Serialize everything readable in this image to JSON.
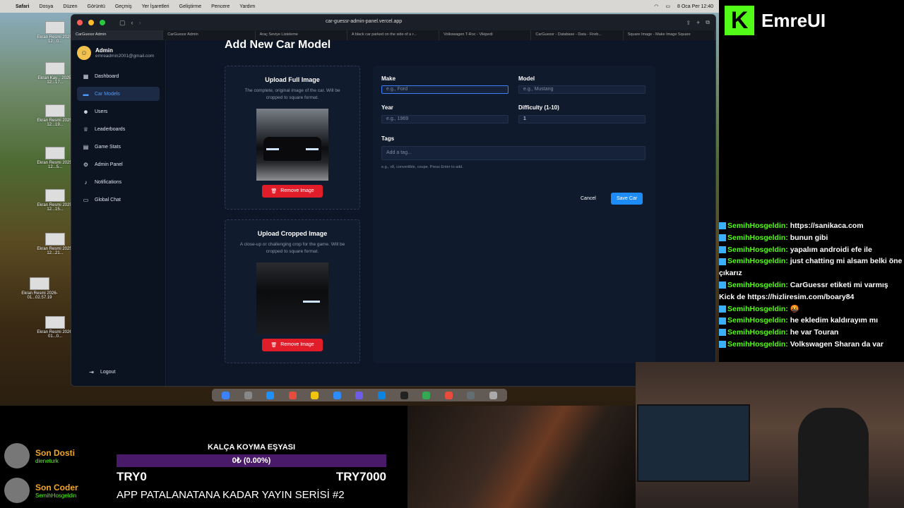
{
  "menubar": {
    "apple": "",
    "app": "Safari",
    "items": [
      "Dosya",
      "Düzen",
      "Görüntü",
      "Geçmiş",
      "Yer İşaretleri",
      "Geliştirme",
      "Pencere",
      "Yardım"
    ],
    "datetime": "8 Oca Per 12:40"
  },
  "desktop_icons": [
    {
      "label": "Ekran Resmi 2025-12...0..."
    },
    {
      "label": "Ekran Kay... 2025-12...17..."
    },
    {
      "label": "Ekran Resmi 2025-12...19..."
    },
    {
      "label": "Ekran Resmi 2025-12...5..."
    },
    {
      "label": "Ekran Resmi 2025-12...15..."
    },
    {
      "label": "Ekran Resmi 2025-12...21..."
    },
    {
      "label": "Ekran Resmi 2026-01...02.57.19"
    },
    {
      "label": "Ekran Resmi 2026-01...0..."
    }
  ],
  "browser": {
    "url": "car-guessr-admin-panel.vercel.app",
    "tabs": [
      "CarGuessr Admin",
      "CarGuessr Admin",
      "Araç Seviye Listeleme",
      "A black car parked on the side of a r...",
      "Volkswagen T-Roc - Vikipedi",
      "CarGuessr - Database - Data - Fireb...",
      "Square Image - Make Image Square"
    ]
  },
  "sidebar": {
    "user_name": "Admin",
    "user_email": "emreadmin2001@gmail.com",
    "items": [
      "Dashboard",
      "Car Models",
      "Users",
      "Leaderboards",
      "Game Stats",
      "Admin Panel",
      "Notifications",
      "Global Chat"
    ],
    "logout": "Logout"
  },
  "page": {
    "title": "Add New Car Model",
    "full_image": {
      "title": "Upload Full Image",
      "desc": "The complete, original image of the car. Will be cropped to square format.",
      "remove": "Remove Image"
    },
    "cropped_image": {
      "title": "Upload Cropped Image",
      "desc": "A close-up or challenging crop for the game. Will be cropped to square format.",
      "remove": "Remove Image"
    },
    "form": {
      "make_label": "Make",
      "make_placeholder": "e.g., Ford",
      "model_label": "Model",
      "model_placeholder": "e.g., Mustang",
      "year_label": "Year",
      "year_placeholder": "e.g., 1969",
      "difficulty_label": "Difficulty (1-10)",
      "difficulty_value": "1",
      "tags_label": "Tags",
      "tags_placeholder": "Add a tag...",
      "tags_hint": "e.g., v8, convertible, coupe. Press Enter to add.",
      "cancel": "Cancel",
      "save": "Save Car"
    }
  },
  "stream": {
    "brand": "EmreUI",
    "chat": [
      {
        "user": "SemihHosgeldin:",
        "msg": "https://sanikaca.com"
      },
      {
        "user": "SemihHosgeldin:",
        "msg": "bunun gibi"
      },
      {
        "user": "SemihHosgeldin:",
        "msg": "yapalım androidi efe ile"
      },
      {
        "user": "SemihHosgeldin:",
        "msg": "just chatting mi alsam belki öne çıkarız"
      },
      {
        "user": "SemihHosgeldin:",
        "msg": "CarGuessr etiketi mi varmış Kick de https://hizliresim.com/boary84"
      },
      {
        "user": "SemihHosgeldin:",
        "msg": "🤬"
      },
      {
        "user": "SemihHosgeldin:",
        "msg": "he ekledim kaldırayım mı"
      },
      {
        "user": "SemihHosgeldin:",
        "msg": "he var Touran"
      },
      {
        "user": "SemihHosgeldin:",
        "msg": "Volkswagen Sharan da var"
      }
    ],
    "last_follower": {
      "title": "Son Dosti",
      "name": "dieneturk"
    },
    "last_coder": {
      "title": "Son Coder",
      "name": "SemihHosgeldin"
    },
    "goal": {
      "title": "KALÇA KOYMA EŞYASI",
      "progress_text": "0₺ (0.00%)",
      "progress": 0,
      "min": "TRY0",
      "max": "TRY7000"
    },
    "series_title": "APP PATALANATANA KADAR YAYIN SERİSİ #2"
  }
}
